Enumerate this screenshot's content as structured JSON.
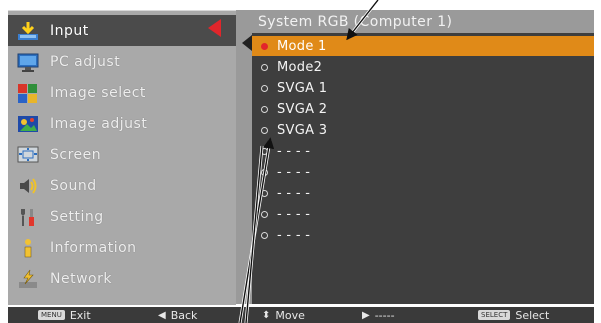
{
  "left_menu": {
    "items": [
      {
        "label": "Input",
        "icon": "input-arrow-icon",
        "selected": true
      },
      {
        "label": "PC adjust",
        "icon": "monitor-icon"
      },
      {
        "label": "Image select",
        "icon": "palette-icon"
      },
      {
        "label": "Image adjust",
        "icon": "image-adjust-icon"
      },
      {
        "label": "Screen",
        "icon": "screen-icon"
      },
      {
        "label": "Sound",
        "icon": "speaker-icon"
      },
      {
        "label": "Setting",
        "icon": "tools-icon"
      },
      {
        "label": "Information",
        "icon": "info-icon"
      },
      {
        "label": "Network",
        "icon": "network-icon"
      }
    ]
  },
  "right_panel": {
    "title": "System RGB (Computer 1)",
    "items": [
      {
        "label": "Mode 1",
        "selected": true
      },
      {
        "label": "Mode2"
      },
      {
        "label": "SVGA 1"
      },
      {
        "label": "SVGA 2"
      },
      {
        "label": "SVGA 3"
      },
      {
        "label": "- - - -"
      },
      {
        "label": "- - - -"
      },
      {
        "label": "- - - -"
      },
      {
        "label": "- - - -"
      },
      {
        "label": "- - - -"
      }
    ]
  },
  "bottom_bar": {
    "exit_key": "MENU",
    "exit_label": "Exit",
    "back_glyph": "◀",
    "back_label": "Back",
    "move_glyph": "⬍",
    "move_label": "Move",
    "enter_glyph": "▶",
    "enter_label": "-----",
    "select_key": "SELECT",
    "select_label": "Select"
  },
  "colors": {
    "menu_bg": "#a9a9a9",
    "list_bg": "#3e3e3e",
    "highlight": "#e08a18",
    "pointer_red": "#e0262b",
    "bottom_bar": "#3a3a3a"
  }
}
